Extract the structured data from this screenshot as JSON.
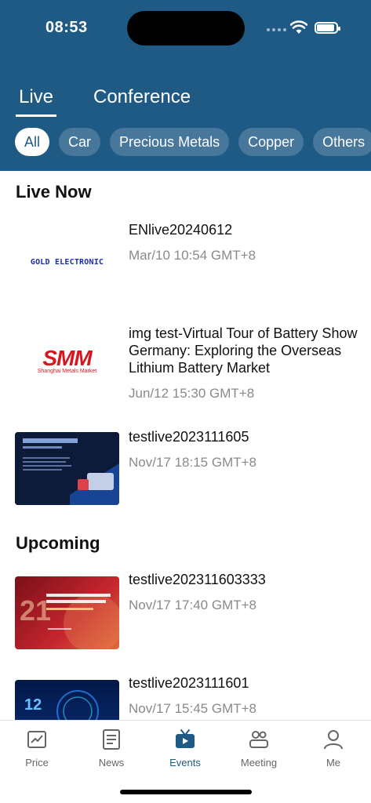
{
  "status": {
    "time": "08:53"
  },
  "tabs": [
    {
      "label": "Live"
    },
    {
      "label": "Conference"
    }
  ],
  "chips": [
    {
      "label": "All"
    },
    {
      "label": "Car"
    },
    {
      "label": "Precious Metals"
    },
    {
      "label": "Copper"
    },
    {
      "label": "Others"
    }
  ],
  "sections": {
    "live_now": "Live Now",
    "upcoming": "Upcoming"
  },
  "live_items": [
    {
      "title": "ENlive20240612",
      "time": "Mar/10 10:54 GMT+8",
      "thumb": "GOLD ELECTRONIC"
    },
    {
      "title": "img test-Virtual Tour of Battery Show Germany: Exploring the Overseas Lithium Battery Market",
      "time": "Jun/12 15:30 GMT+8",
      "thumb_logo": "SMM",
      "thumb_sub": "Shanghai Metals Market"
    },
    {
      "title": "testlive2023111605",
      "time": "Nov/17 18:15 GMT+8"
    }
  ],
  "upcoming_items": [
    {
      "title": "testlive202311603333",
      "time": "Nov/17 17:40 GMT+8"
    },
    {
      "title": "testlive2023111601",
      "time": "Nov/17 15:45 GMT+8"
    }
  ],
  "tabbar": [
    {
      "label": "Price",
      "icon": "chart-icon"
    },
    {
      "label": "News",
      "icon": "news-icon"
    },
    {
      "label": "Events",
      "icon": "tv-icon"
    },
    {
      "label": "Meeting",
      "icon": "meeting-icon"
    },
    {
      "label": "Me",
      "icon": "person-icon"
    }
  ],
  "colors": {
    "header": "#1f5a85",
    "accent": "#1f5a85"
  }
}
